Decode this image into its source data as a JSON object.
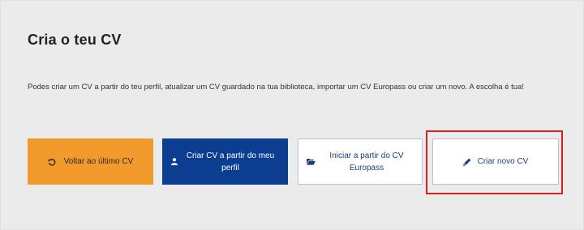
{
  "card": {
    "title": "Cria o teu CV",
    "description": "Podes criar um CV a partir do teu perfil, atualizar um CV guardado na tua biblioteca, importar um CV Europass ou criar um novo. A escolha é tua!"
  },
  "buttons": {
    "back_last": {
      "label": "Voltar ao último CV",
      "icon": "undo-icon",
      "color": "#f29a2b"
    },
    "from_profile": {
      "label": "Criar CV a partir do meu perfil",
      "icon": "user-icon",
      "color": "#0b3d91"
    },
    "from_europass": {
      "label": "Iniciar a partir do CV Europass",
      "icon": "folder-open-icon"
    },
    "new_cv": {
      "label": "Criar novo CV",
      "icon": "pencil-icon"
    }
  },
  "highlight_color": "#e02020"
}
